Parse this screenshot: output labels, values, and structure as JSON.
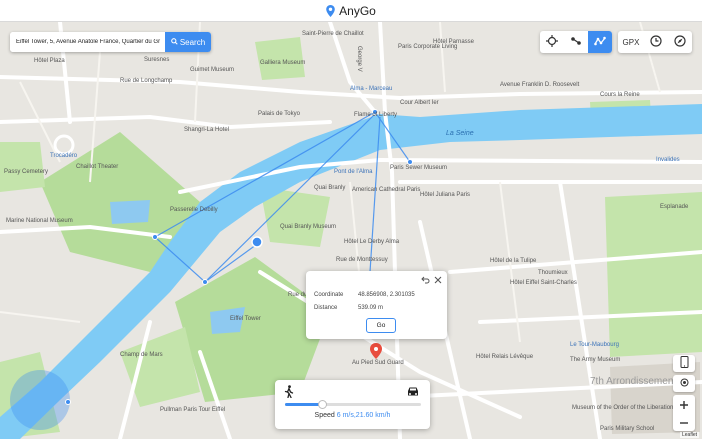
{
  "app": {
    "title": "AnyGo"
  },
  "search": {
    "value": "Eiffel Tower, 5, Avenue Anatole France, Quartier du Gr",
    "button_label": "Search"
  },
  "toolbar": {
    "gpx_label": "GPX"
  },
  "popup": {
    "coordinate_label": "Coordinate",
    "coordinate_value": "48.856908, 2.301035",
    "distance_label": "Distance",
    "distance_value": "539.09 m",
    "go_label": "Go"
  },
  "speed": {
    "label": "Speed",
    "value_text": "6 m/s,21.60 km/h",
    "level": 0.27
  },
  "attribution": "Leaflet",
  "map_labels": [
    "Saint-Pierre de Chaillot",
    "Hôtel Plaza",
    "Paris Corporate Living",
    "Hôtel Parnasse",
    "Rue de Longchamp",
    "Suresnes",
    "Guimet Museum",
    "Galliera Museum",
    "George V",
    "Alma - Marceau",
    "Cours la Reine",
    "Avenue Franklin D. Roosevelt",
    "Cour Albert Ier",
    "Palais de Tokyo",
    "Shangri-La Hotel",
    "Flame of Liberty",
    "Trocadéro",
    "Chaillot Theater",
    "Passy Cemetery",
    "Marine National Museum",
    "Passerelle Debilly",
    "Paris Sewer Museum",
    "Pont de l'Alma",
    "Quai Branly",
    "Hôtel Juliana Paris",
    "American Cathedral Paris",
    "Quai Branly Museum",
    "Hôtel Le Derby Alma",
    "Rue de Monttessuy",
    "Rue du Champ de Mars",
    "Eiffel Tower",
    "Champ de Mars",
    "Au Pied Sud Guard",
    "Hôtel Relais Lévêque",
    "Hôtel de la Tulipe",
    "Thoumieux",
    "Hôtel Eiffel Saint-Charles",
    "Le Tour-Maubourg",
    "The Army Museum",
    "Museum of the Order of the Liberation",
    "Paris Military School",
    "Pullman Paris Tour Eiffel",
    "7th Arrondissement",
    "La Seine",
    "Invalides",
    "Esplanade"
  ]
}
